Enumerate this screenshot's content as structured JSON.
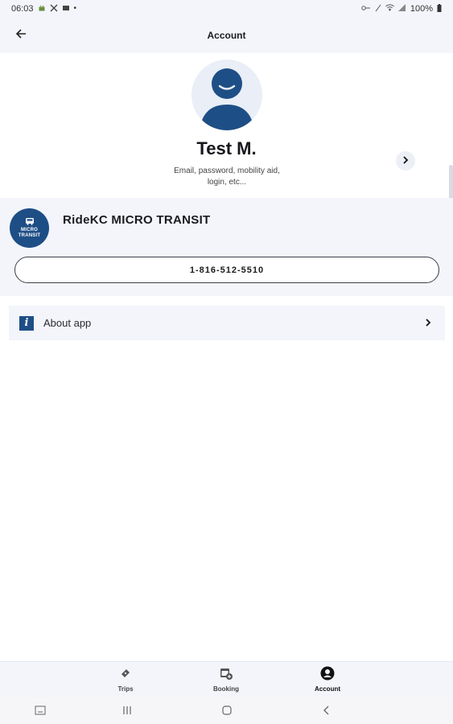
{
  "status_bar": {
    "time": "06:03",
    "left_icons": [
      "android-icon",
      "tools-icon",
      "cast-icon",
      "dot-icon"
    ],
    "right_icons": [
      "key-icon",
      "mute-icon",
      "wifi-icon",
      "signal-icon"
    ],
    "battery": "100%"
  },
  "app_bar": {
    "title": "Account"
  },
  "profile": {
    "name": "Test M.",
    "subtitle": "Email, password, mobility aid, login, etc..."
  },
  "agency": {
    "logo_line1": "MICRO",
    "logo_line2": "TRANSIT",
    "name": "RideKC MICRO TRANSIT",
    "phone": "1-816-512-5510"
  },
  "about": {
    "label": "About app"
  },
  "bottom_nav": {
    "items": [
      {
        "label": "Trips",
        "icon": "ticket-icon"
      },
      {
        "label": "Booking",
        "icon": "calendar-add-icon"
      },
      {
        "label": "Account",
        "icon": "user-circle-icon",
        "active": true
      }
    ]
  },
  "colors": {
    "brand": "#1e4e86",
    "surface": "#f3f5fb",
    "text": "#1b1b1f"
  }
}
